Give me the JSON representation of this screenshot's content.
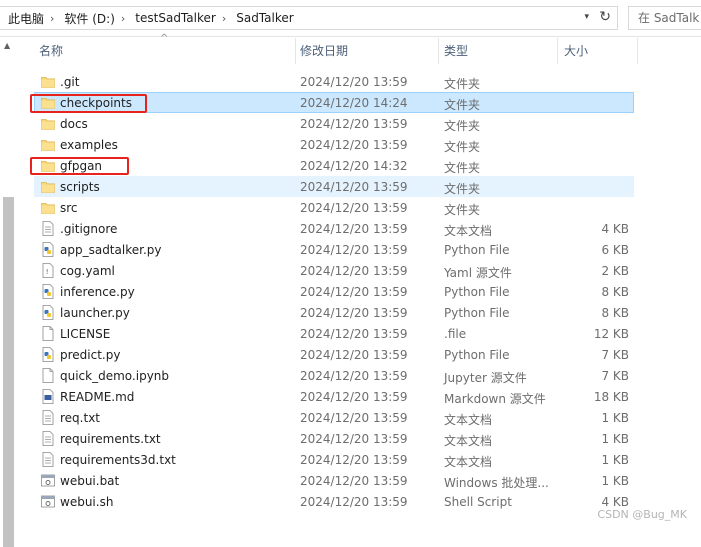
{
  "address_bar": {
    "breadcrumbs": [
      "此电脑",
      "软件 (D:)",
      "testSadTalker",
      "SadTalker"
    ],
    "search_placeholder": "在 SadTalk"
  },
  "columns": {
    "name": "名称",
    "date": "修改日期",
    "type": "类型",
    "size": "大小"
  },
  "files": [
    {
      "name": ".git",
      "date": "2024/12/20 13:59",
      "type": "文件夹",
      "size": "",
      "icon": "folder-icon"
    },
    {
      "name": "checkpoints",
      "date": "2024/12/20 14:24",
      "type": "文件夹",
      "size": "",
      "icon": "folder-icon",
      "state": "selected"
    },
    {
      "name": "docs",
      "date": "2024/12/20 13:59",
      "type": "文件夹",
      "size": "",
      "icon": "folder-icon"
    },
    {
      "name": "examples",
      "date": "2024/12/20 13:59",
      "type": "文件夹",
      "size": "",
      "icon": "folder-icon"
    },
    {
      "name": "gfpgan",
      "date": "2024/12/20 14:32",
      "type": "文件夹",
      "size": "",
      "icon": "folder-icon"
    },
    {
      "name": "scripts",
      "date": "2024/12/20 13:59",
      "type": "文件夹",
      "size": "",
      "icon": "folder-icon",
      "state": "hovered"
    },
    {
      "name": "src",
      "date": "2024/12/20 13:59",
      "type": "文件夹",
      "size": "",
      "icon": "folder-icon"
    },
    {
      "name": ".gitignore",
      "date": "2024/12/20 13:59",
      "type": "文本文档",
      "size": "4 KB",
      "icon": "text-file-icon"
    },
    {
      "name": "app_sadtalker.py",
      "date": "2024/12/20 13:59",
      "type": "Python File",
      "size": "6 KB",
      "icon": "python-file-icon"
    },
    {
      "name": "cog.yaml",
      "date": "2024/12/20 13:59",
      "type": "Yaml 源文件",
      "size": "2 KB",
      "icon": "yaml-file-icon"
    },
    {
      "name": "inference.py",
      "date": "2024/12/20 13:59",
      "type": "Python File",
      "size": "8 KB",
      "icon": "python-file-icon"
    },
    {
      "name": "launcher.py",
      "date": "2024/12/20 13:59",
      "type": "Python File",
      "size": "8 KB",
      "icon": "python-file-icon"
    },
    {
      "name": "LICENSE",
      "date": "2024/12/20 13:59",
      "type": ".file",
      "size": "12 KB",
      "icon": "blank-file-icon"
    },
    {
      "name": "predict.py",
      "date": "2024/12/20 13:59",
      "type": "Python File",
      "size": "7 KB",
      "icon": "python-file-icon"
    },
    {
      "name": "quick_demo.ipynb",
      "date": "2024/12/20 13:59",
      "type": "Jupyter 源文件",
      "size": "7 KB",
      "icon": "blank-file-icon"
    },
    {
      "name": "README.md",
      "date": "2024/12/20 13:59",
      "type": "Markdown 源文件",
      "size": "18 KB",
      "icon": "markdown-file-icon"
    },
    {
      "name": "req.txt",
      "date": "2024/12/20 13:59",
      "type": "文本文档",
      "size": "1 KB",
      "icon": "text-file-icon"
    },
    {
      "name": "requirements.txt",
      "date": "2024/12/20 13:59",
      "type": "文本文档",
      "size": "1 KB",
      "icon": "text-file-icon"
    },
    {
      "name": "requirements3d.txt",
      "date": "2024/12/20 13:59",
      "type": "文本文档",
      "size": "1 KB",
      "icon": "text-file-icon"
    },
    {
      "name": "webui.bat",
      "date": "2024/12/20 13:59",
      "type": "Windows 批处理...",
      "size": "1 KB",
      "icon": "batch-file-icon"
    },
    {
      "name": "webui.sh",
      "date": "2024/12/20 13:59",
      "type": "Shell Script",
      "size": "4 KB",
      "icon": "batch-file-icon"
    }
  ],
  "annotations": [
    "checkpoints",
    "gfpgan"
  ],
  "watermark": "CSDN @Bug_MK",
  "colors": {
    "selected_bg": "#cce8ff",
    "hover_bg": "#e5f3ff",
    "folder": "#f8d775",
    "annotation_red": "#e8231b",
    "header_text": "#4c607a"
  }
}
